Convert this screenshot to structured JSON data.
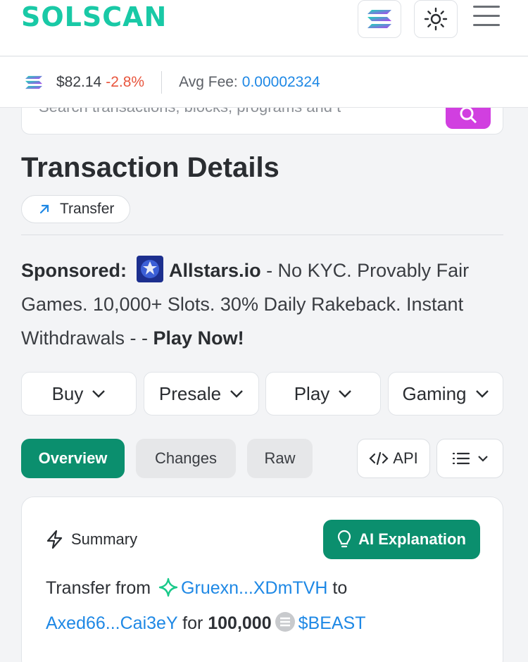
{
  "header": {
    "logo_text": "SOLSCAN"
  },
  "pricebar": {
    "price": "$82.14",
    "change": "-2.8%",
    "fee_label": "Avg Fee:",
    "fee_value": "0.00002324"
  },
  "search": {
    "placeholder": "Search transactions, blocks, programs and t"
  },
  "page": {
    "title": "Transaction Details",
    "type_chip": "Transfer"
  },
  "sponsor": {
    "label": "Sponsored:",
    "brand": "Allstars.io",
    "text": " - No KYC. Provably Fair Games. 10,000+ Slots. 30% Daily Rakeback. Instant Withdrawals - - ",
    "cta": "Play Now!"
  },
  "dropdowns": [
    "Buy",
    "Presale",
    "Play",
    "Gaming"
  ],
  "tabs": {
    "overview": "Overview",
    "changes": "Changes",
    "raw": "Raw",
    "api": "API"
  },
  "summary": {
    "title": "Summary",
    "ai_button": "AI Explanation",
    "prefix": "Transfer from ",
    "from": "Gruexn...XDmTVH",
    "to_word": " to",
    "to": "Axed66...Cai3eY",
    "for_word": " for ",
    "amount": "100,000",
    "token": "$BEAST"
  },
  "colors": {
    "brand": "#19c9a6",
    "accent": "#0b8f6e",
    "link": "#1e88e5",
    "negative": "#e8553d",
    "search_button": "#d13fe0"
  }
}
